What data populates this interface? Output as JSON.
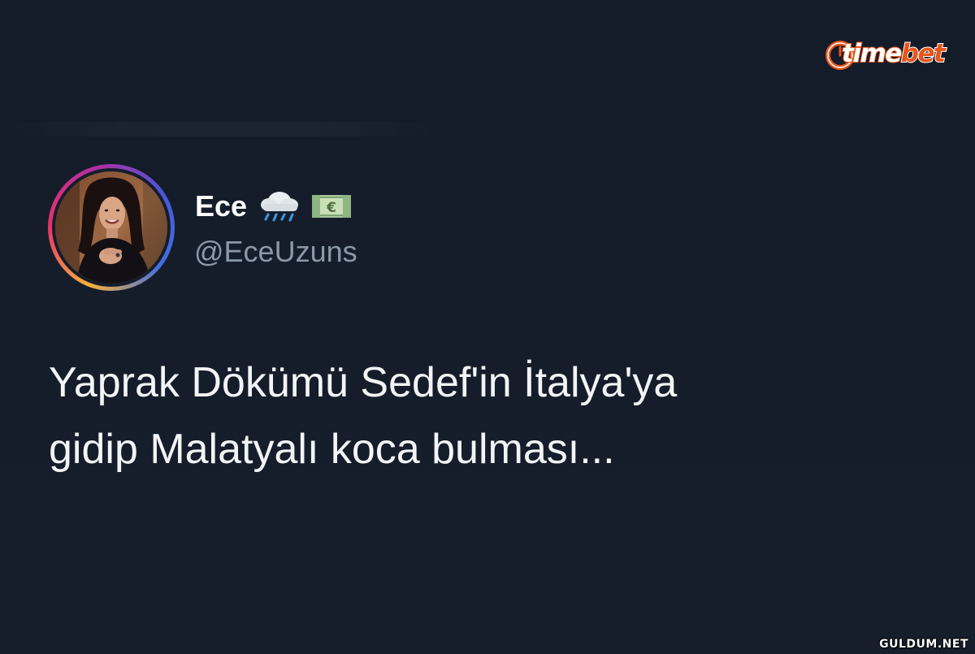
{
  "brand": {
    "logo_text_part1": "time",
    "logo_text_part2": "bet",
    "accent_color": "#e8551a"
  },
  "tweet": {
    "author_name": "Ece",
    "author_emojis": [
      "cloud-with-rain-icon",
      "euro-banknote-icon"
    ],
    "author_handle": "@EceUzuns",
    "text_lines": [
      "Yaprak Dökümü Sedef'in İtalya'ya",
      "gidip Malatyalı koca bulması..."
    ]
  },
  "watermark": {
    "text": "GULDUM.NET"
  },
  "colors": {
    "background": "#151d2b",
    "primary_text": "#f2f4f6",
    "secondary_text": "#8b98a5"
  }
}
